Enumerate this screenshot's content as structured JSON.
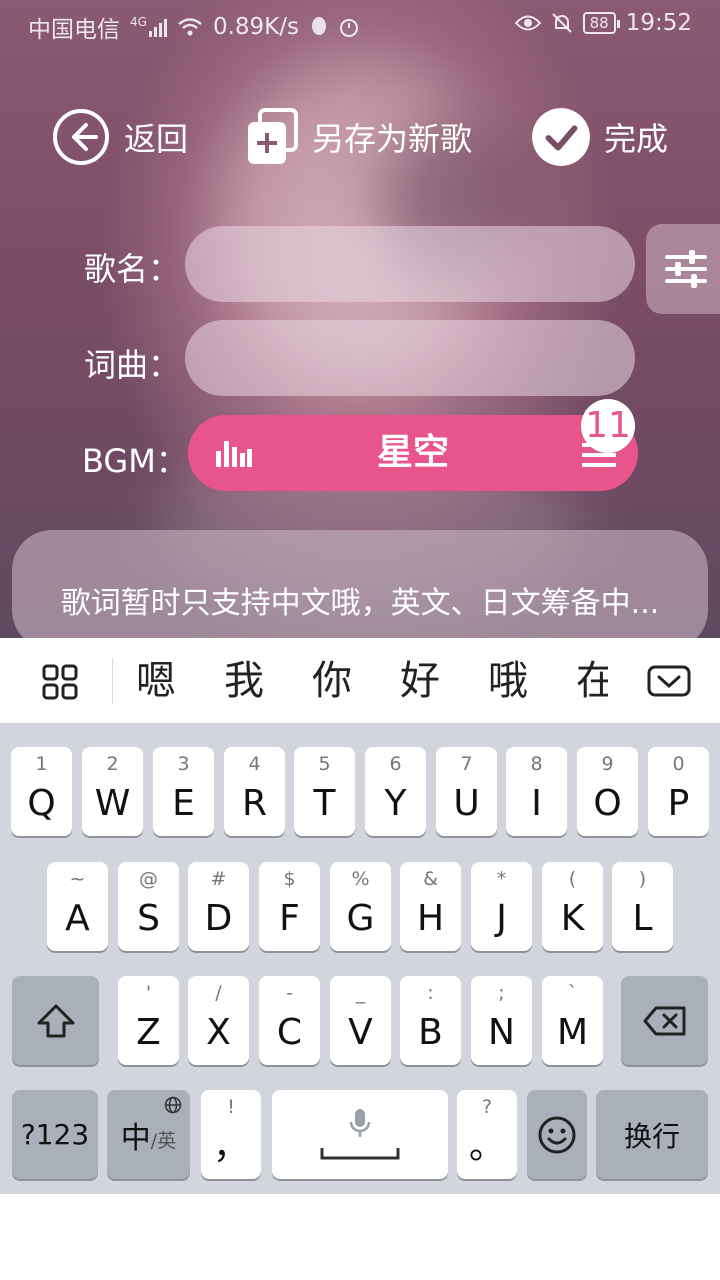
{
  "status_bar": {
    "carrier": "中国电信",
    "network": "4G",
    "speed": "0.89K/s",
    "battery": "88",
    "time": "19:52"
  },
  "toolbar": {
    "back_label": "返回",
    "save_as_label": "另存为新歌",
    "done_label": "完成"
  },
  "form": {
    "song_name_label": "歌名：",
    "song_name_value": "",
    "lyrics_label": "词曲：",
    "lyrics_value": "",
    "bgm_label": "BGM：",
    "bgm_name": "星空",
    "bgm_count": "11"
  },
  "notice": "歌词暂时只支持中文哦，英文、日文筹备中...",
  "candidates": [
    "嗯",
    "我",
    "你",
    "好",
    "哦",
    "在"
  ],
  "keyboard": {
    "row1": [
      {
        "hint": "1",
        "key": "Q"
      },
      {
        "hint": "2",
        "key": "W"
      },
      {
        "hint": "3",
        "key": "E"
      },
      {
        "hint": "4",
        "key": "R"
      },
      {
        "hint": "5",
        "key": "T"
      },
      {
        "hint": "6",
        "key": "Y"
      },
      {
        "hint": "7",
        "key": "U"
      },
      {
        "hint": "8",
        "key": "I"
      },
      {
        "hint": "9",
        "key": "O"
      },
      {
        "hint": "0",
        "key": "P"
      }
    ],
    "row2": [
      {
        "hint": "~",
        "key": "A"
      },
      {
        "hint": "@",
        "key": "S"
      },
      {
        "hint": "#",
        "key": "D"
      },
      {
        "hint": "$",
        "key": "F"
      },
      {
        "hint": "%",
        "key": "G"
      },
      {
        "hint": "&",
        "key": "H"
      },
      {
        "hint": "*",
        "key": "J"
      },
      {
        "hint": "(",
        "key": "K"
      },
      {
        "hint": ")",
        "key": "L"
      }
    ],
    "row3": [
      {
        "hint": "'",
        "key": "Z"
      },
      {
        "hint": "/",
        "key": "X"
      },
      {
        "hint": "-",
        "key": "C"
      },
      {
        "hint": "_",
        "key": "V"
      },
      {
        "hint": ":",
        "key": "B"
      },
      {
        "hint": ";",
        "key": "N"
      },
      {
        "hint": "`",
        "key": "M"
      }
    ],
    "num_label": "?123",
    "lang_main": "中",
    "lang_sub": "/英",
    "comma_hint": "!",
    "comma_key": "，",
    "period_hint": "?",
    "period_key": "。",
    "enter_label": "换行"
  },
  "colors": {
    "accent": "#e8558a",
    "keyboard_bg": "#d2d5dc",
    "function_key": "#aab0ba"
  }
}
